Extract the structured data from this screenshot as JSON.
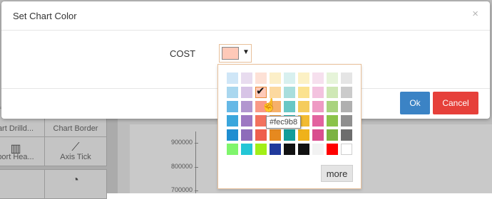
{
  "background": {
    "tiles": [
      {
        "label": "art Drilld...",
        "icon": "drilldown-icon"
      },
      {
        "label": "Chart Border",
        "icon": "border-icon"
      },
      {
        "label": "port Hea...",
        "icon": "report-header-icon"
      },
      {
        "label": "Axis Tick",
        "icon": "axis-tick-icon"
      },
      {
        "label": "",
        "icon": "pie-icon"
      }
    ],
    "axis_ticks": [
      "900000",
      "800000",
      "700000"
    ]
  },
  "dialog": {
    "title": "Set Chart Color",
    "close_glyph": "×",
    "field_label": "COST",
    "selected_color": "#fec9b8",
    "caret": "▼",
    "ok_label": "Ok",
    "cancel_label": "Cancel",
    "ok_color": "#3b83c5",
    "cancel_color": "#e6403a"
  },
  "palette": {
    "rows": [
      [
        "#cfe6f7",
        "#e8dcef",
        "#fde1d6",
        "#fcefc8",
        "#d8f0ef",
        "#fcf1c5",
        "#f6e0ee",
        "#e6f4d9",
        "#e5e5e5"
      ],
      [
        "#a9d7ef",
        "#d7c4e6",
        "#fec9b8",
        "#fcd9a0",
        "#a9dedd",
        "#fbe28f",
        "#f3c2df",
        "#cfe8b5",
        "#cbcbcb"
      ],
      [
        "#65b8e6",
        "#b296cf",
        "#f99a86",
        "#f6b06a",
        "#69c7c5",
        "#f5cc5c",
        "#ee9ac4",
        "#a9d37e",
        "#b0b0b0"
      ],
      [
        "#3aa6dc",
        "#9e78c2",
        "#f2725e",
        "#ef9b3c",
        "#2bb3b0",
        "#f2bb31",
        "#e2639f",
        "#8bc34a",
        "#8f8f8f"
      ],
      [
        "#1f8ed1",
        "#8e6cba",
        "#ef5f4c",
        "#e6891f",
        "#129d9a",
        "#efb21a",
        "#d94e8f",
        "#7cb342",
        "#6d6d6d"
      ],
      [
        "#7ff56c",
        "#23c6d6",
        "#a2ef17",
        "#213a9c",
        "#111111",
        "#111111",
        "#f2f2f2",
        "#ff0000",
        "#ffffff"
      ]
    ],
    "selected": {
      "row": 1,
      "col": 2
    },
    "check_glyph": "✔",
    "tooltip": "#fec9b8",
    "more_label": "more"
  }
}
